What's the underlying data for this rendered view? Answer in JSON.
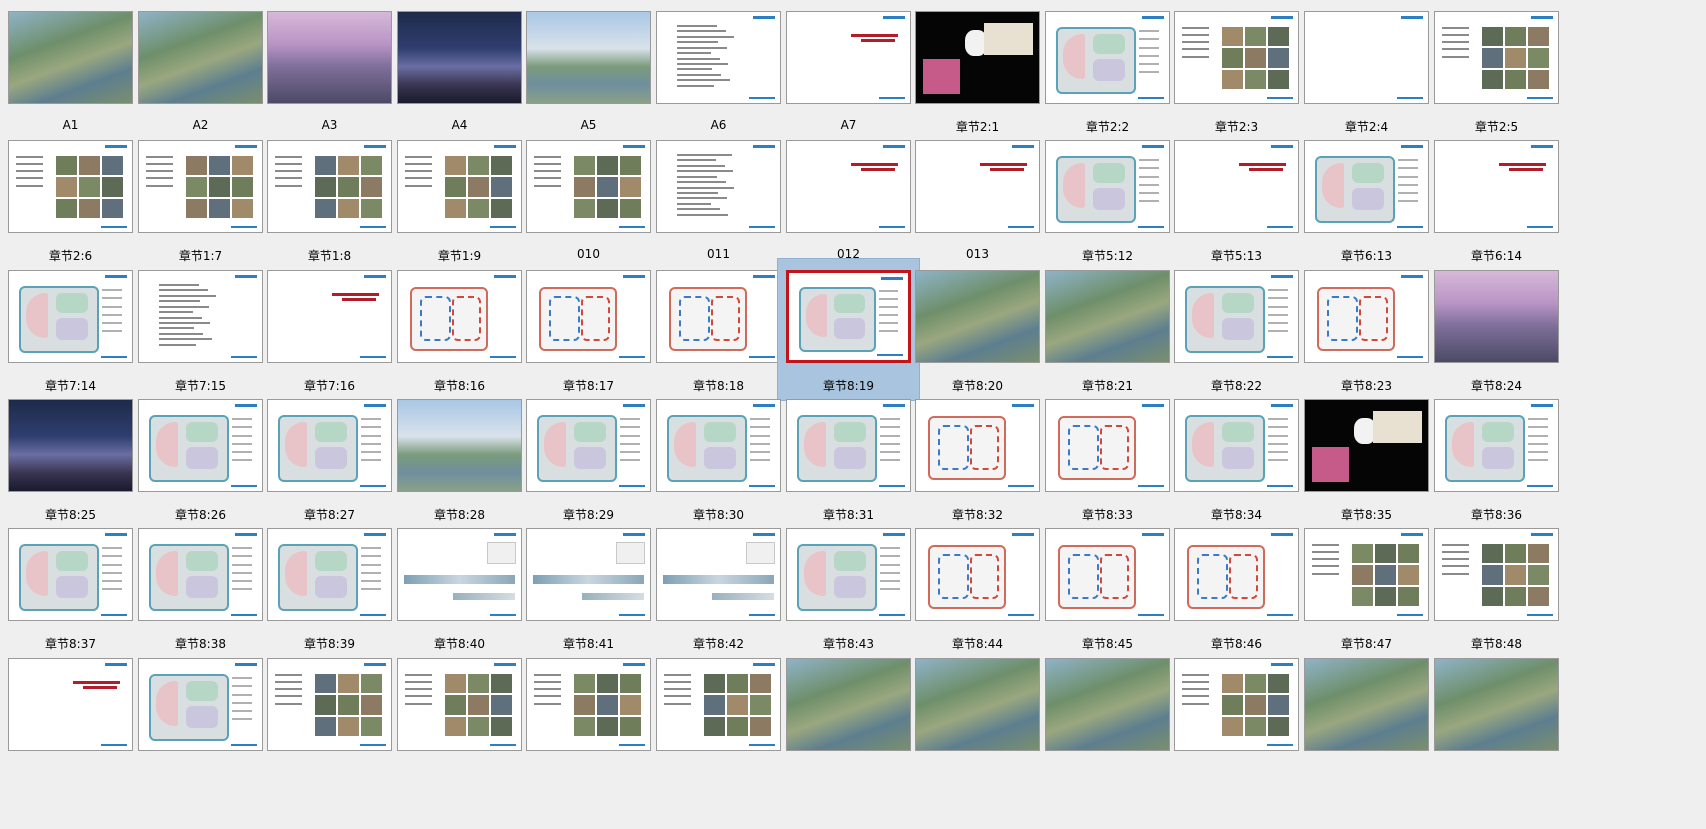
{
  "window": {
    "title": ""
  },
  "colors": {
    "selection": "#a9c4de",
    "selected_border": "#c3141a",
    "accent": "#2e7fc1"
  },
  "slides": [
    {
      "label": "A1",
      "kind": "aerial"
    },
    {
      "label": "A2",
      "kind": "aerial"
    },
    {
      "label": "A3",
      "kind": "dusk"
    },
    {
      "label": "A4",
      "kind": "night"
    },
    {
      "label": "A5",
      "kind": "day"
    },
    {
      "label": "A6",
      "kind": "text"
    },
    {
      "label": "A7",
      "kind": "title"
    },
    {
      "label": "章节2:1",
      "kind": "black"
    },
    {
      "label": "章节2:2",
      "kind": "plan"
    },
    {
      "label": "章节2:3",
      "kind": "photos"
    },
    {
      "label": "章节2:4",
      "kind": "blank"
    },
    {
      "label": "章节2:5",
      "kind": "photos"
    },
    {
      "label": "章节2:6",
      "kind": "photos"
    },
    {
      "label": "章节1:7",
      "kind": "photos"
    },
    {
      "label": "章节1:8",
      "kind": "photos"
    },
    {
      "label": "章节1:9",
      "kind": "photos"
    },
    {
      "label": "010",
      "kind": "photos"
    },
    {
      "label": "011",
      "kind": "text"
    },
    {
      "label": "012",
      "kind": "title"
    },
    {
      "label": "013",
      "kind": "title"
    },
    {
      "label": "章节5:12",
      "kind": "plan"
    },
    {
      "label": "章节5:13",
      "kind": "title"
    },
    {
      "label": "章节6:13",
      "kind": "plan"
    },
    {
      "label": "章节6:14",
      "kind": "title"
    },
    {
      "label": "章节7:14",
      "kind": "plan"
    },
    {
      "label": "章节7:15",
      "kind": "text"
    },
    {
      "label": "章节7:16",
      "kind": "title"
    },
    {
      "label": "章节8:16",
      "kind": "diagram"
    },
    {
      "label": "章节8:17",
      "kind": "diagram"
    },
    {
      "label": "章节8:18",
      "kind": "diagram"
    },
    {
      "label": "章节8:19",
      "kind": "plan",
      "selected": true
    },
    {
      "label": "章节8:20",
      "kind": "aerial"
    },
    {
      "label": "章节8:21",
      "kind": "aerial"
    },
    {
      "label": "章节8:22",
      "kind": "plan"
    },
    {
      "label": "章节8:23",
      "kind": "diagram"
    },
    {
      "label": "章节8:24",
      "kind": "dusk"
    },
    {
      "label": "章节8:25",
      "kind": "night"
    },
    {
      "label": "章节8:26",
      "kind": "plan"
    },
    {
      "label": "章节8:27",
      "kind": "plan"
    },
    {
      "label": "章节8:28",
      "kind": "day"
    },
    {
      "label": "章节8:29",
      "kind": "plan"
    },
    {
      "label": "章节8:30",
      "kind": "plan"
    },
    {
      "label": "章节8:31",
      "kind": "plan"
    },
    {
      "label": "章节8:32",
      "kind": "diagram"
    },
    {
      "label": "章节8:33",
      "kind": "diagram"
    },
    {
      "label": "章节8:34",
      "kind": "plan"
    },
    {
      "label": "章节8:35",
      "kind": "black"
    },
    {
      "label": "章节8:36",
      "kind": "plan"
    },
    {
      "label": "章节8:37",
      "kind": "plan"
    },
    {
      "label": "章节8:38",
      "kind": "plan"
    },
    {
      "label": "章节8:39",
      "kind": "plan"
    },
    {
      "label": "章节8:40",
      "kind": "elevation"
    },
    {
      "label": "章节8:41",
      "kind": "elevation"
    },
    {
      "label": "章节8:42",
      "kind": "elevation"
    },
    {
      "label": "章节8:43",
      "kind": "plan"
    },
    {
      "label": "章节8:44",
      "kind": "diagram"
    },
    {
      "label": "章节8:45",
      "kind": "diagram"
    },
    {
      "label": "章节8:46",
      "kind": "diagram"
    },
    {
      "label": "章节8:47",
      "kind": "photos"
    },
    {
      "label": "章节8:48",
      "kind": "photos"
    },
    {
      "label": "",
      "kind": "title"
    },
    {
      "label": "",
      "kind": "plan"
    },
    {
      "label": "",
      "kind": "photos"
    },
    {
      "label": "",
      "kind": "photos"
    },
    {
      "label": "",
      "kind": "photos"
    },
    {
      "label": "",
      "kind": "photos"
    },
    {
      "label": "",
      "kind": "aerial"
    },
    {
      "label": "",
      "kind": "aerial"
    },
    {
      "label": "",
      "kind": "aerial"
    },
    {
      "label": "",
      "kind": "photos"
    },
    {
      "label": "",
      "kind": "aerial"
    },
    {
      "label": "",
      "kind": "aerial"
    }
  ]
}
